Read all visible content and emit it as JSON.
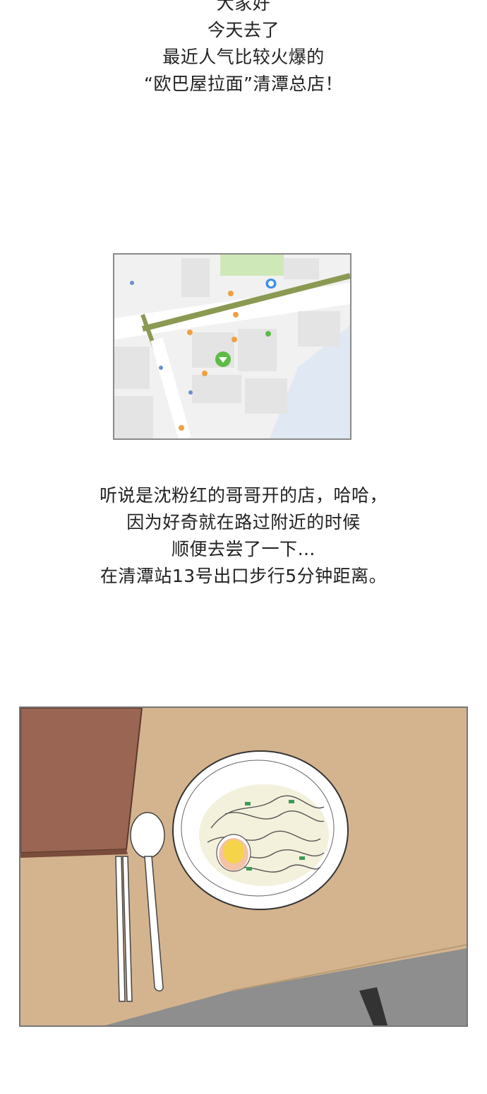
{
  "caption_top": {
    "lines": [
      "大家好",
      "今天去了",
      "最近人气比较火爆的",
      "“欧巴屋拉面”清潭总店！"
    ]
  },
  "caption_mid": {
    "lines": [
      "听说是沈粉红的哥哥开的店，哈哈，",
      "因为好奇就在路过附近的时候",
      "顺便去尝了一下…",
      "在清潭站13号出口步行5分钟距离。"
    ]
  },
  "colors": {
    "map_bg": "#f1f1f1",
    "map_park": "#cfe8b8",
    "map_rail": "#8a9a52",
    "map_water": "#dfe8f3",
    "pin_blue": "#3d8ee8",
    "pin_green": "#5dbb46",
    "table": "#d4b48e",
    "menu_book": "#9a6552",
    "floor": "#8e8e8e"
  },
  "icons": [
    "subway-pin-icon",
    "destination-pin-icon"
  ]
}
